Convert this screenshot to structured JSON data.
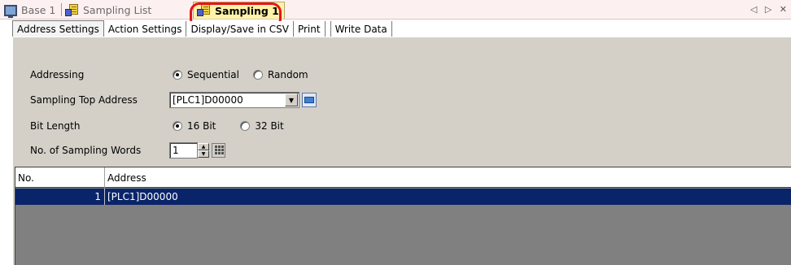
{
  "doc_tabs": [
    {
      "label": "Base 1",
      "icon": "monitor-icon"
    },
    {
      "label": "Sampling List",
      "icon": "sampling-icon"
    },
    {
      "label": "Sampling 1",
      "icon": "sampling-icon",
      "active": true
    }
  ],
  "nav_arrows": "◁ ▷ ✕",
  "sub_tabs": [
    "Address Settings",
    "Action Settings",
    "Display/Save in CSV",
    "Print",
    "Write Data"
  ],
  "form": {
    "addressing_label": "Addressing",
    "addressing_options": [
      "Sequential",
      "Random"
    ],
    "addressing_selected": "Sequential",
    "top_address_label": "Sampling Top Address",
    "top_address_value": "[PLC1]D00000",
    "bit_length_label": "Bit Length",
    "bit_length_options": [
      "16 Bit",
      "32 Bit"
    ],
    "bit_length_selected": "16 Bit",
    "words_label": "No. of Sampling Words",
    "words_value": "1"
  },
  "table": {
    "columns": [
      "No.",
      "Address"
    ],
    "rows": [
      {
        "no": "1",
        "address": "[PLC1]D00000"
      }
    ]
  },
  "colors": {
    "highlight": "#e6141b",
    "selection": "#0a246a",
    "active_tab": "#fff3a8"
  }
}
